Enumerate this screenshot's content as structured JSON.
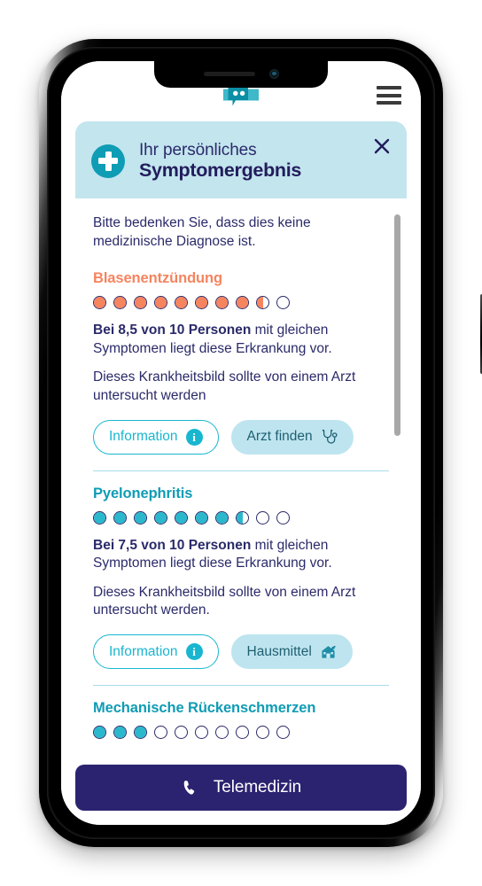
{
  "app": {
    "brand_logo_icon": "medical-chat-cross-logo",
    "menu_icon": "hamburger-menu-icon",
    "colors": {
      "brand_teal": "#0f9cb5",
      "bright_teal": "#19b6d0",
      "header_bg": "#c3e5ee",
      "navy": "#2a2a6a",
      "orange": "#f5845f",
      "cta_navy": "#2b2370",
      "divider": "#a9dde8"
    }
  },
  "card": {
    "header": {
      "badge_icon": "plus-cross-icon",
      "subtitle": "Ihr persönliches",
      "title": "Symptomergebnis",
      "close_icon": "close-x-icon"
    },
    "disclaimer": "Bitte bedenken Sie, dass dies keine medizinische Diagnose ist."
  },
  "results": [
    {
      "name": "Blasenentzündung",
      "name_color": "#f5845f",
      "dot_color": "#f5845f",
      "dots_total": 10,
      "dots_full": 8,
      "dots_half": 1,
      "score": 8.5,
      "stat_bold": "Bei 8,5 von 10 Personen",
      "stat_rest": " mit gleichen Symptomen liegt diese Erkrankung vor.",
      "advice": "Dieses Krankheitsbild sollte von einem Arzt untersucht werden",
      "buttons": [
        {
          "label": "Information",
          "style": "outline",
          "icon": "info-circle-icon"
        },
        {
          "label": "Arzt finden",
          "style": "filled",
          "icon": "stethoscope-icon"
        }
      ]
    },
    {
      "name": "Pyelonephritis",
      "name_color": "#0f9cb5",
      "dot_color": "#2bb8cc",
      "dots_total": 10,
      "dots_full": 7,
      "dots_half": 1,
      "score": 7.5,
      "stat_bold": "Bei 7,5 von 10 Personen",
      "stat_rest": " mit gleichen Symptomen liegt diese Erkrankung vor.",
      "advice": "Dieses Krankheitsbild sollte von einem Arzt untersucht werden.",
      "buttons": [
        {
          "label": "Information",
          "style": "outline",
          "icon": "info-circle-icon"
        },
        {
          "label": "Hausmittel",
          "style": "filled",
          "icon": "home-remedy-icon"
        }
      ]
    },
    {
      "name": "Mechanische Rückenschmerzen",
      "name_color": "#0f9cb5",
      "dot_color": "#2bb8cc",
      "dots_total": 10,
      "dots_full": 3,
      "dots_half": 0,
      "score": 3
    }
  ],
  "cta": {
    "label": "Telemedizin",
    "icon": "phone-handset-icon"
  }
}
